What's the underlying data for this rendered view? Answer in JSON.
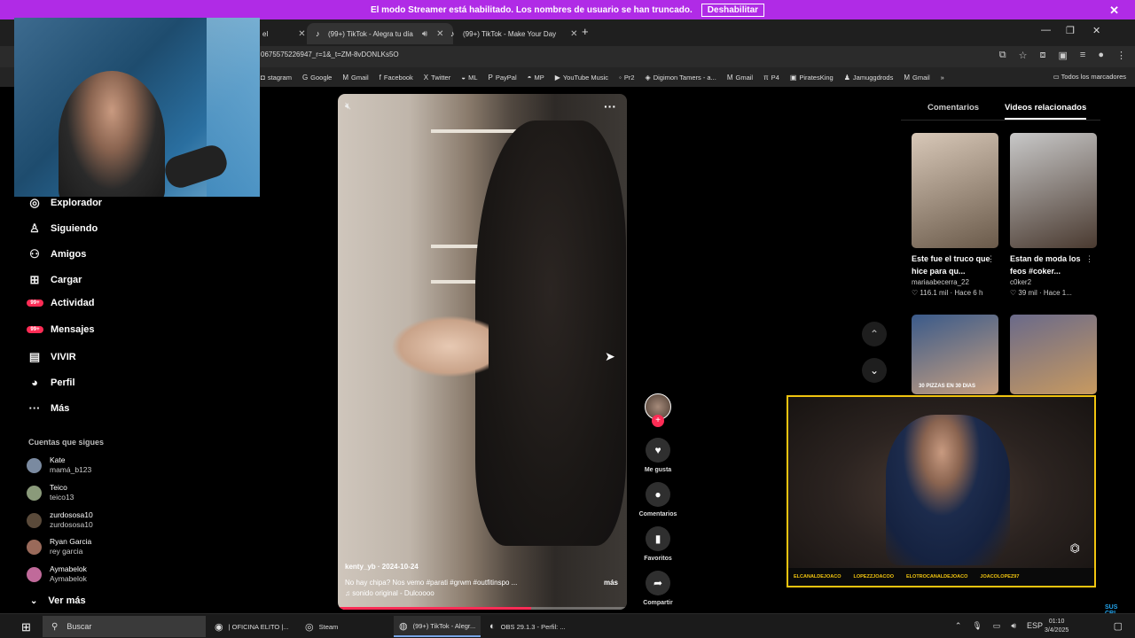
{
  "banner": {
    "text": "El modo Streamer está habilitado. Los nombres de usuario se han truncado.",
    "button": "Deshabilitar",
    "close": "✕"
  },
  "browser": {
    "tabs": [
      {
        "label": "el"
      },
      {
        "label": "(99+) TikTok - Alegra tu día"
      },
      {
        "label": "(99+) TikTok - Make Your Day"
      }
    ],
    "url": "0675575226947_r=1&_t=ZM-8vDONLKs5O",
    "bookmarks": [
      {
        "label": "stagram",
        "icon": "instagram-icon"
      },
      {
        "label": "Google",
        "icon": "google-icon"
      },
      {
        "label": "Gmail",
        "icon": "gmail-icon"
      },
      {
        "label": "Facebook",
        "icon": "facebook-icon"
      },
      {
        "label": "Twitter",
        "icon": "x-icon"
      },
      {
        "label": "ML",
        "icon": "ml-icon"
      },
      {
        "label": "PayPal",
        "icon": "paypal-icon"
      },
      {
        "label": "MP",
        "icon": "mp-icon"
      },
      {
        "label": "YouTube Music",
        "icon": "youtube-music-icon"
      },
      {
        "label": "Pr2",
        "icon": "pr2-icon"
      },
      {
        "label": "Digimon Tamers - a...",
        "icon": "digimon-icon"
      },
      {
        "label": "Gmail",
        "icon": "gmail-icon"
      },
      {
        "label": "P4",
        "icon": "p4-icon"
      },
      {
        "label": "PiratesKing",
        "icon": "piratesking-icon"
      },
      {
        "label": "Jamuggdrods",
        "icon": "jamuggdrods-icon"
      },
      {
        "label": "Gmail",
        "icon": "gmail-icon"
      }
    ],
    "all_bookmarks": "Todos los marcadores"
  },
  "sidebar": {
    "nav": [
      {
        "label": "Explorador",
        "icon": "compass-icon"
      },
      {
        "label": "Siguiendo",
        "icon": "following-icon"
      },
      {
        "label": "Amigos",
        "icon": "friends-icon"
      },
      {
        "label": "Cargar",
        "icon": "upload-icon"
      },
      {
        "label": "Actividad",
        "icon": "activity-icon",
        "badge": "99+"
      },
      {
        "label": "Mensajes",
        "icon": "messages-icon",
        "badge": "99+"
      },
      {
        "label": "VIVIR",
        "icon": "live-icon"
      },
      {
        "label": "Perfil",
        "icon": "profile-icon"
      },
      {
        "label": "Más",
        "icon": "more-icon"
      }
    ],
    "following_title": "Cuentas que sigues",
    "accounts": [
      {
        "name": "Kate",
        "handle": "mamá_b123",
        "color": "#7a8aa0"
      },
      {
        "name": "Teico",
        "handle": "teico13",
        "color": "#8a9a7a"
      },
      {
        "name": "zurdososa10",
        "handle": "zurdososa10",
        "color": "#5a4a3a"
      },
      {
        "name": "Ryan Garcia",
        "handle": "rey garcia",
        "color": "#9a6a5a"
      },
      {
        "name": "Aymabelok",
        "handle": "Aymabelok",
        "color": "#c06a9a"
      }
    ],
    "see_more": "Ver más"
  },
  "video": {
    "author_date": "kenty_yb · 2024-10-24",
    "caption": "No hay chipa? Nos vemo #parati #grwm #outfitinspo ...",
    "sound": "♫ sonido original - Dulcoooo",
    "more": "más",
    "progress": 0.67
  },
  "actions": {
    "like": "Me gusta",
    "comments": "Comentarios",
    "favorites": "Favoritos",
    "share": "Compartir"
  },
  "right_panel": {
    "tabs": [
      "Comentarios",
      "Videos relacionados"
    ],
    "cards": [
      {
        "desc": "Este fue el truco que hice para qu...",
        "author": "mariaabecerra_22",
        "stats": "♡ 116.1 mil · Hace 6 h",
        "colors": [
          "#d8c8b8",
          "#6a5a4a"
        ]
      },
      {
        "desc": "Estan de moda los feos #coker...",
        "author": "c0ker2",
        "stats": "♡ 39 mil · Hace 1...",
        "colors": [
          "#c8c8c8",
          "#4a3a30"
        ]
      },
      {
        "label": "30 PIZZAS EN 30 DIAS",
        "colors": [
          "#3a5a8a",
          "#c8a080"
        ]
      },
      {
        "colors": [
          "#6a6a8a",
          "#c89a60"
        ]
      }
    ]
  },
  "overlay": {
    "socials": [
      "ELCANALDEJOACO",
      "LOPEZZJOACOO",
      "ELOTROCANALDEJOACO",
      "JOACOLOPEZ97"
    ],
    "subscribe": "SUS CRI BITE"
  },
  "taskbar": {
    "search": "Buscar",
    "apps": [
      {
        "label": "| OFICINA ELITO |...",
        "icon": "discord-icon"
      },
      {
        "label": "Steam",
        "icon": "steam-icon"
      },
      {
        "label": "(99+) TikTok - Alegr...",
        "icon": "chrome-icon"
      },
      {
        "label": "OBS 29.1.3 - Perfil: ...",
        "icon": "obs-icon"
      }
    ],
    "lang": "ESP",
    "time": "01:10",
    "date": "3/4/2025"
  }
}
